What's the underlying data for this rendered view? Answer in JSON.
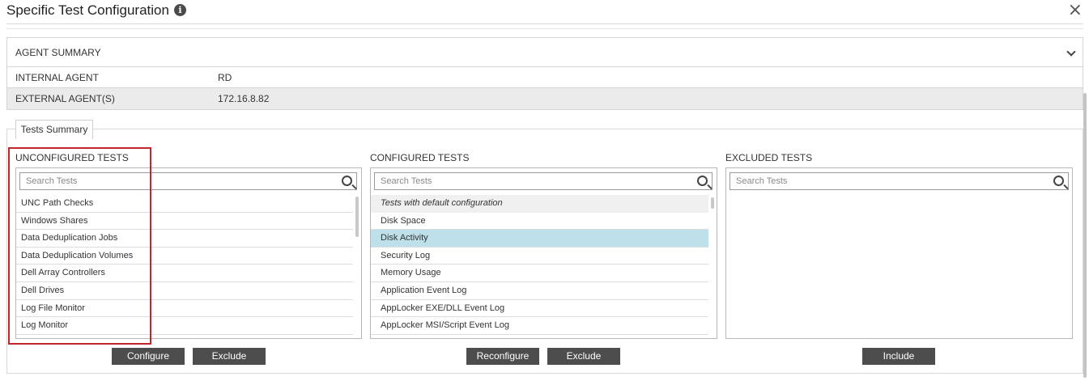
{
  "dialog": {
    "title": "Specific Test Configuration",
    "info_icon": "i",
    "close_icon": "×"
  },
  "agent_summary": {
    "header": "AGENT SUMMARY",
    "rows": [
      {
        "label": "INTERNAL AGENT",
        "value": "RD"
      },
      {
        "label": "EXTERNAL AGENT(S)",
        "value": "172.16.8.82"
      }
    ]
  },
  "tests_summary": {
    "tab_label": "Tests Summary",
    "unconfigured": {
      "title": "UNCONFIGURED TESTS",
      "search_placeholder": "Search Tests",
      "items": [
        "UNC Path Checks",
        "Windows Shares",
        "Data Deduplication Jobs",
        "Data Deduplication Volumes",
        "Dell Array Controllers",
        "Dell Drives",
        "Log File Monitor",
        "Log Monitor"
      ],
      "buttons": {
        "configure": "Configure",
        "exclude": "Exclude"
      }
    },
    "configured": {
      "title": "CONFIGURED TESTS",
      "search_placeholder": "Search Tests",
      "group_label": "Tests with default configuration",
      "items": [
        "Disk Space",
        "Disk Activity",
        "Security Log",
        "Memory Usage",
        "Application Event Log",
        "AppLocker EXE/DLL Event Log",
        "AppLocker MSI/Script Event Log"
      ],
      "selected_item": "Disk Activity",
      "buttons": {
        "reconfigure": "Reconfigure",
        "exclude": "Exclude"
      }
    },
    "excluded": {
      "title": "EXCLUDED TESTS",
      "search_placeholder": "Search Tests",
      "items": [],
      "buttons": {
        "include": "Include"
      }
    }
  },
  "colors": {
    "button_bg": "#4d4d4d",
    "selected_row": "#bde0ea",
    "highlight_border": "#c0262a"
  },
  "icons": [
    "info-icon",
    "close-icon",
    "chevron-down-icon",
    "search-icon"
  ]
}
